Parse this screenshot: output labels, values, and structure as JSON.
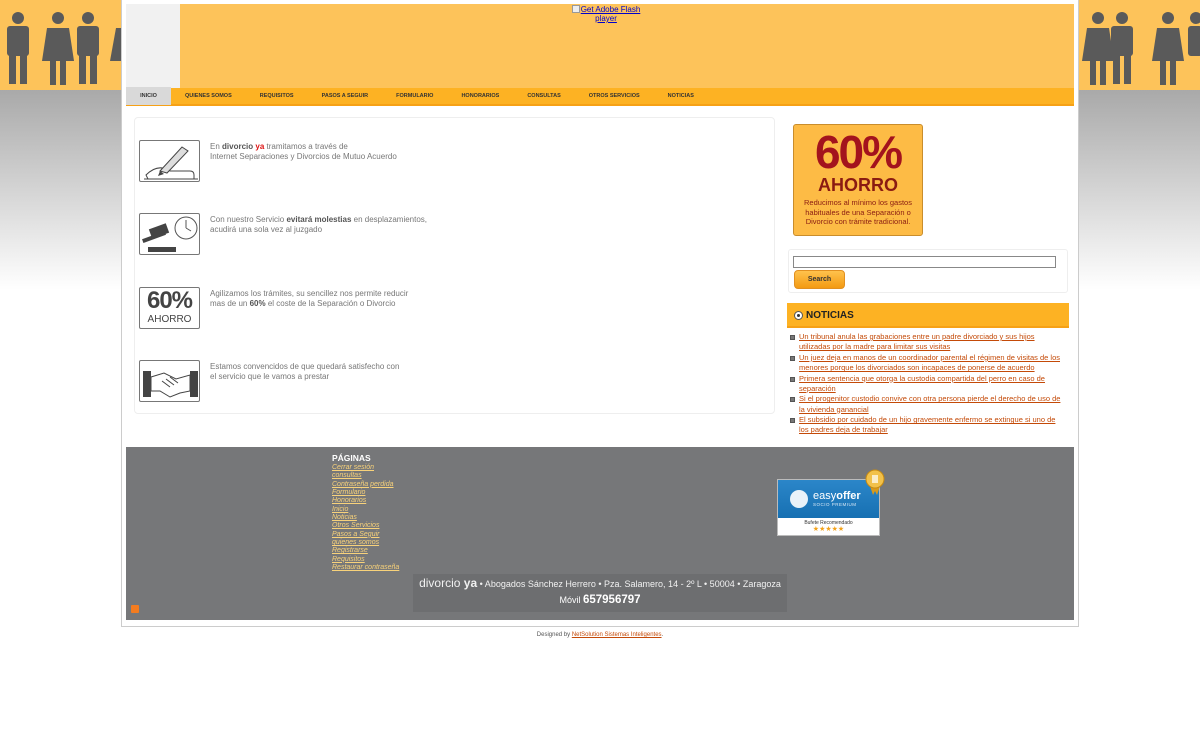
{
  "flash": {
    "alt": "Get Adobe Flash player"
  },
  "nav": {
    "items": [
      "INICIO",
      "QUIENES SOMOS",
      "REQUISITOS",
      "PASOS A SEGUIR",
      "FORMULARIO",
      "HONORARIOS",
      "CONSULTAS",
      "OTROS SERVICIOS",
      "NOTICIAS"
    ]
  },
  "features": {
    "f1": {
      "pre": "En ",
      "brand1": "divorcio",
      "brand2": "ya",
      "post": " tramitamos a través de",
      "line2": "Internet Separaciones y Divorcios de Mutuo Acuerdo"
    },
    "f2": {
      "pre": "Con nuestro Servicio ",
      "bold": "evitará molestias",
      "post": " en desplazamientos,",
      "line2": "acudirá una sola vez al juzgado"
    },
    "f3": {
      "line1": "Agilizamos los trámites, su sencillez nos permite reducir",
      "pre": "mas de un ",
      "bold": "60%",
      "post": " el coste de la Separación o Divorcio",
      "icon_big": "60%",
      "icon_small": "AHORRO"
    },
    "f4": {
      "line1": "Estamos convencidos de que quedará satisfecho con",
      "line2": "el servicio que le vamos a prestar"
    }
  },
  "promo": {
    "big": "60%",
    "ahorro": "AHORRO",
    "desc1": "Reducimos al mínimo los gastos",
    "desc2": "habituales de una Separación o",
    "desc3": "Divorcio con trámite tradicional."
  },
  "search": {
    "value": "",
    "button": "Search"
  },
  "news": {
    "title": "NOTICIAS",
    "items": [
      "Un tribunal anula las grabaciones entre un padre divorciado y sus hijos utilizadas por la madre para limitar sus visitas",
      "Un juez deja en manos de un coordinador parental el régimen de visitas de los menores porque los divorciados son incapaces de ponerse de acuerdo",
      "Primera sentencia que otorga la custodia compartida del perro en caso de separación",
      "Si el progenitor custodio convive con otra persona pierde el derecho de uso de la vivienda ganancial",
      "El subsidio por cuidado de un hijo gravemente enfermo se extingue si uno de los padres deja de trabajar"
    ]
  },
  "footer": {
    "pages_title": "PÁGINAS",
    "pages": [
      "Cerrar sesión",
      "consultas",
      "Contraseña perdida",
      "Formulario",
      "Honorarios",
      "Inicio",
      "Noticias",
      "Otros Servicios",
      "Pasos a Seguir",
      "quienes somos",
      "Registrarse",
      "Requisitos",
      "Restaurar contraseña"
    ],
    "badge_name_a": "easy",
    "badge_name_b": "offer",
    "badge_sub": "SOCIO PREMIUM",
    "badge_text": "Bufete Recomendado",
    "badge_stars": "★★★★★",
    "logo_a": "divorcio",
    "logo_b": "ya",
    "address": " • Abogados Sánchez Herrero • Pza. Salamero, 14 - 2º L • 50004 • Zaragoza",
    "mobile_label": "Móvil ",
    "mobile_number": "657956797"
  },
  "credit": {
    "pre": "Designed by ",
    "link": "NetSolution Sistemas Inteligentes",
    "post": "."
  }
}
